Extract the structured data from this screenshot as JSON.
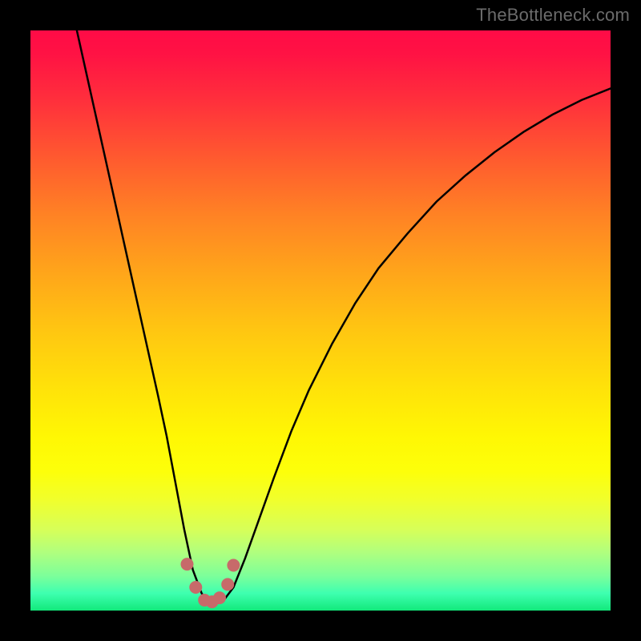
{
  "watermark": {
    "text": "TheBottleneck.com"
  },
  "chart_data": {
    "type": "line",
    "title": "",
    "xlabel": "",
    "ylabel": "",
    "xlim": [
      0,
      100
    ],
    "ylim": [
      0,
      100
    ],
    "grid": false,
    "legend": false,
    "background": "rainbow-gradient (red top to green bottom)",
    "series": [
      {
        "name": "bottleneck-curve",
        "stroke": "#000000",
        "stroke_width": 2.5,
        "x": [
          8,
          10,
          12,
          14,
          16,
          18,
          20,
          22,
          23.5,
          25,
          26.5,
          28,
          29.5,
          30.5,
          31.5,
          32.5,
          33.5,
          35,
          37,
          39.5,
          42,
          45,
          48,
          52,
          56,
          60,
          65,
          70,
          75,
          80,
          85,
          90,
          95,
          100
        ],
        "y_pct": [
          100,
          91,
          82,
          73,
          64,
          55,
          46,
          37,
          30,
          22,
          14,
          7,
          3,
          1.5,
          1.2,
          1.3,
          2,
          4,
          9,
          16,
          23,
          31,
          38,
          46,
          53,
          59,
          65,
          70.5,
          75,
          79,
          82.5,
          85.5,
          88,
          90
        ]
      }
    ],
    "markers": [
      {
        "name": "valley-dots",
        "fill": "#c76a6a",
        "radius_pct": 1.1,
        "points_xy_pct": [
          [
            27.0,
            8.0
          ],
          [
            28.5,
            4.0
          ],
          [
            30.0,
            1.8
          ],
          [
            31.3,
            1.5
          ],
          [
            32.6,
            2.2
          ],
          [
            34.0,
            4.5
          ],
          [
            35.0,
            7.8
          ]
        ]
      }
    ]
  }
}
